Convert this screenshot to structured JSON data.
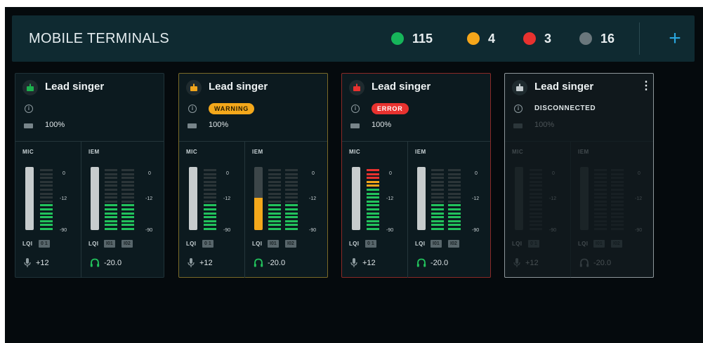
{
  "header": {
    "title": "MOBILE TERMINALS",
    "add_label": "+",
    "counts": [
      {
        "value": "115",
        "color": "#16b55a"
      },
      {
        "value": "4",
        "color": "#f5a61a"
      },
      {
        "value": "3",
        "color": "#e8322f"
      },
      {
        "value": "16",
        "color": "#6a777c"
      }
    ]
  },
  "scale_labels": [
    "0",
    "-12",
    "-90"
  ],
  "cards": [
    {
      "name": "Lead singer",
      "state": "normal",
      "icon_color": "#1db04e",
      "status": "",
      "battery": "100%",
      "mic": {
        "label": "MIC",
        "lqi_label": "LQI",
        "lqi_badges": [
          "0 1"
        ],
        "gain": "+12",
        "level": 0.47,
        "peak_colors": 0
      },
      "iem": {
        "label": "IEM",
        "lqi_label": "LQI",
        "lqi_badges": [
          "I01",
          "I02"
        ],
        "gain": "-20.0",
        "levels": [
          0.47,
          0.47
        ],
        "color": "#22c25c"
      }
    },
    {
      "name": "Lead singer",
      "state": "warning",
      "icon_color": "#f0a51c",
      "status": "WARNING",
      "battery": "100%",
      "mic": {
        "label": "MIC",
        "lqi_label": "LQI",
        "lqi_badges": [
          "0 1"
        ],
        "gain": "+12",
        "level": 0.47,
        "peak_colors": 0
      },
      "iem": {
        "label": "IEM",
        "lqi_label": "LQI",
        "lqi_badges": [
          "I01",
          "I02"
        ],
        "gain": "-20.0",
        "levels": [
          0.47,
          0.47
        ],
        "color": "#22c25c"
      }
    },
    {
      "name": "Lead singer",
      "state": "error",
      "icon_color": "#e8322f",
      "status": "ERROR",
      "battery": "100%",
      "mic": {
        "label": "MIC",
        "lqi_label": "LQI",
        "lqi_badges": [
          "0 1"
        ],
        "gain": "+12",
        "level": 1.0,
        "peak_colors": 1
      },
      "iem": {
        "label": "IEM",
        "lqi_label": "LQI",
        "lqi_badges": [
          "I01",
          "I02"
        ],
        "gain": "-20.0",
        "levels": [
          0.47,
          0.47
        ],
        "color": "#22c25c"
      }
    },
    {
      "name": "Lead singer",
      "state": "disconnected",
      "icon_color": "#c5cdd0",
      "status": "DISCONNECTED",
      "battery": "100%",
      "mic": {
        "label": "MIC",
        "lqi_label": "LQI",
        "lqi_badges": [
          "0 1"
        ],
        "gain": "+12",
        "level": 0,
        "peak_colors": 0
      },
      "iem": {
        "label": "IEM",
        "lqi_label": "LQI",
        "lqi_badges": [
          "I01",
          "I02"
        ],
        "gain": "-20.0",
        "levels": [
          0,
          0
        ],
        "color": "#22c25c"
      }
    }
  ]
}
